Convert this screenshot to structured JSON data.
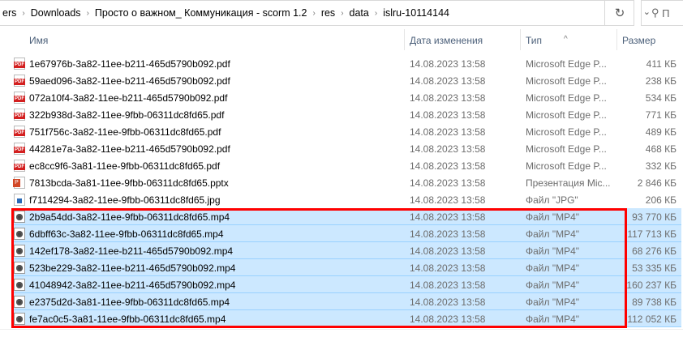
{
  "address": {
    "crumbs": [
      "ers",
      "Downloads",
      "Просто о важном_ Коммуникация - scorm 1.2",
      "res",
      "data",
      "islru-10114144"
    ],
    "search_placeholder": "П"
  },
  "columns": {
    "name": "Имя",
    "date": "Дата изменения",
    "type": "Тип",
    "size": "Размер"
  },
  "files": [
    {
      "name": "1e67976b-3a82-11ee-b211-465d5790b092.pdf",
      "date": "14.08.2023 13:58",
      "type": "Microsoft Edge P...",
      "size": "411 КБ",
      "icon": "pdf",
      "selected": false
    },
    {
      "name": "59aed096-3a82-11ee-b211-465d5790b092.pdf",
      "date": "14.08.2023 13:58",
      "type": "Microsoft Edge P...",
      "size": "238 КБ",
      "icon": "pdf",
      "selected": false
    },
    {
      "name": "072a10f4-3a82-11ee-b211-465d5790b092.pdf",
      "date": "14.08.2023 13:58",
      "type": "Microsoft Edge P...",
      "size": "534 КБ",
      "icon": "pdf",
      "selected": false
    },
    {
      "name": "322b938d-3a82-11ee-9fbb-06311dc8fd65.pdf",
      "date": "14.08.2023 13:58",
      "type": "Microsoft Edge P...",
      "size": "771 КБ",
      "icon": "pdf",
      "selected": false
    },
    {
      "name": "751f756c-3a82-11ee-9fbb-06311dc8fd65.pdf",
      "date": "14.08.2023 13:58",
      "type": "Microsoft Edge P...",
      "size": "489 КБ",
      "icon": "pdf",
      "selected": false
    },
    {
      "name": "44281e7a-3a82-11ee-b211-465d5790b092.pdf",
      "date": "14.08.2023 13:58",
      "type": "Microsoft Edge P...",
      "size": "468 КБ",
      "icon": "pdf",
      "selected": false
    },
    {
      "name": "ec8cc9f6-3a81-11ee-9fbb-06311dc8fd65.pdf",
      "date": "14.08.2023 13:58",
      "type": "Microsoft Edge P...",
      "size": "332 КБ",
      "icon": "pdf",
      "selected": false
    },
    {
      "name": "7813bcda-3a81-11ee-9fbb-06311dc8fd65.pptx",
      "date": "14.08.2023 13:58",
      "type": "Презентация Mic...",
      "size": "2 846 КБ",
      "icon": "ppt",
      "selected": false
    },
    {
      "name": "f7114294-3a82-11ee-9fbb-06311dc8fd65.jpg",
      "date": "14.08.2023 13:58",
      "type": "Файл \"JPG\"",
      "size": "206 КБ",
      "icon": "jpg",
      "selected": false
    },
    {
      "name": "2b9a54dd-3a82-11ee-9fbb-06311dc8fd65.mp4",
      "date": "14.08.2023 13:58",
      "type": "Файл \"MP4\"",
      "size": "93 770 КБ",
      "icon": "mp4",
      "selected": true
    },
    {
      "name": "6dbff63c-3a82-11ee-9fbb-06311dc8fd65.mp4",
      "date": "14.08.2023 13:58",
      "type": "Файл \"MP4\"",
      "size": "117 713 КБ",
      "icon": "mp4",
      "selected": true
    },
    {
      "name": "142ef178-3a82-11ee-b211-465d5790b092.mp4",
      "date": "14.08.2023 13:58",
      "type": "Файл \"MP4\"",
      "size": "68 276 КБ",
      "icon": "mp4",
      "selected": true
    },
    {
      "name": "523be229-3a82-11ee-b211-465d5790b092.mp4",
      "date": "14.08.2023 13:58",
      "type": "Файл \"MP4\"",
      "size": "53 335 КБ",
      "icon": "mp4",
      "selected": true
    },
    {
      "name": "41048942-3a82-11ee-b211-465d5790b092.mp4",
      "date": "14.08.2023 13:58",
      "type": "Файл \"MP4\"",
      "size": "160 237 КБ",
      "icon": "mp4",
      "selected": true
    },
    {
      "name": "e2375d2d-3a81-11ee-9fbb-06311dc8fd65.mp4",
      "date": "14.08.2023 13:58",
      "type": "Файл \"MP4\"",
      "size": "89 738 КБ",
      "icon": "mp4",
      "selected": true
    },
    {
      "name": "fe7ac0c5-3a81-11ee-9fbb-06311dc8fd65.mp4",
      "date": "14.08.2023 13:58",
      "type": "Файл \"MP4\"",
      "size": "112 052 КБ",
      "icon": "mp4",
      "selected": true
    }
  ],
  "colors": {
    "selection": "#cce8ff",
    "highlight": "#ff0000"
  }
}
